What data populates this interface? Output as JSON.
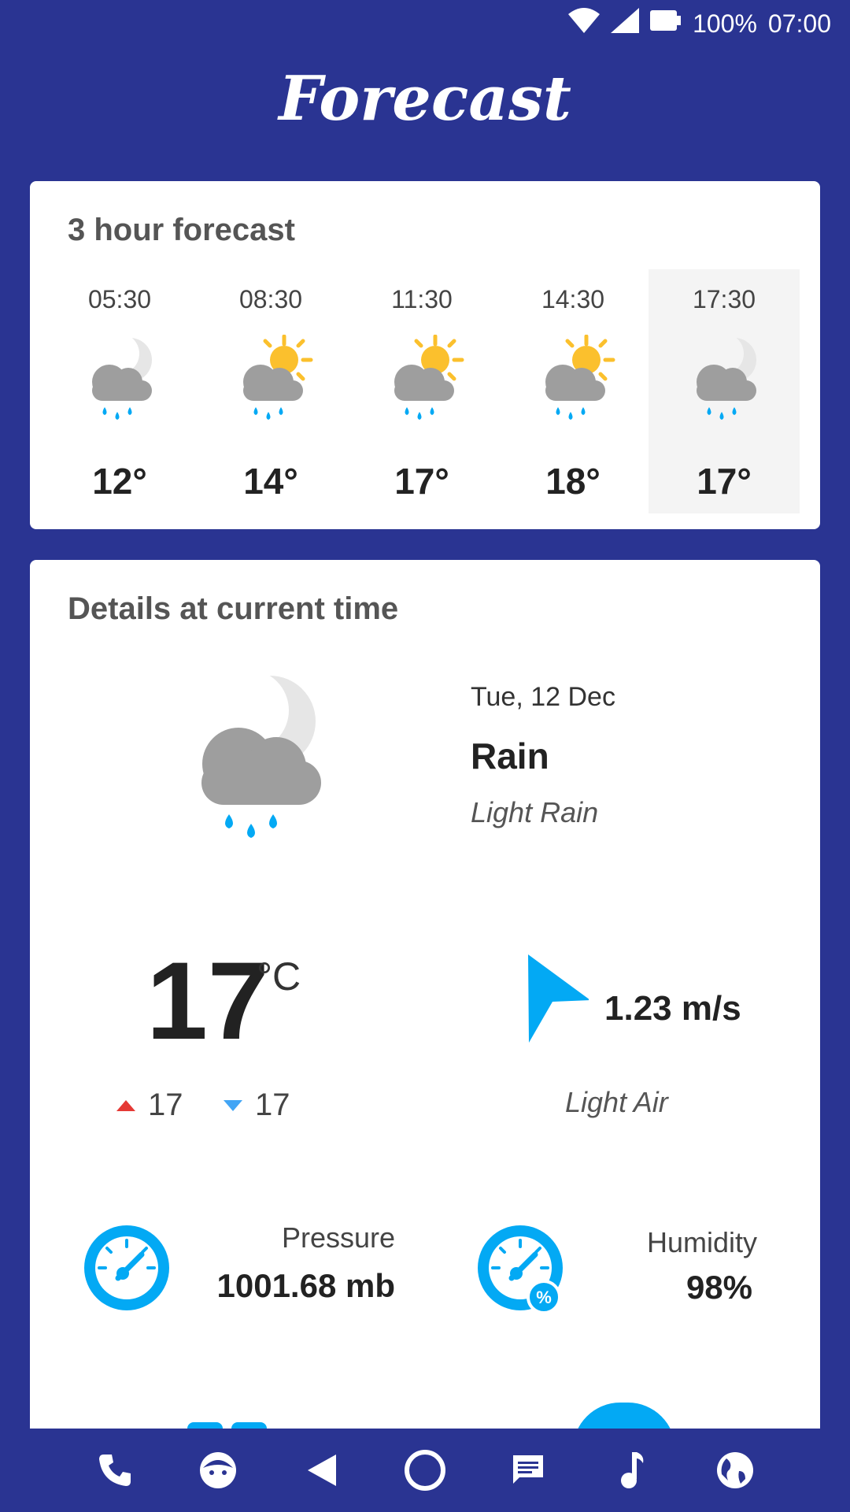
{
  "status": {
    "battery": "100%",
    "time": "07:00"
  },
  "app": {
    "title": "Forecast"
  },
  "three_hour": {
    "title": "3 hour forecast",
    "items": [
      {
        "time": "05:30",
        "temp": "12°",
        "icon": "night-rain-icon"
      },
      {
        "time": "08:30",
        "temp": "14°",
        "icon": "day-rain-icon"
      },
      {
        "time": "11:30",
        "temp": "17°",
        "icon": "day-rain-icon"
      },
      {
        "time": "14:30",
        "temp": "18°",
        "icon": "day-rain-icon"
      },
      {
        "time": "17:30",
        "temp": "17°",
        "icon": "night-rain-icon",
        "selected": true
      }
    ]
  },
  "details": {
    "title": "Details at current time",
    "date": "Tue, 12 Dec",
    "condition": "Rain",
    "description": "Light Rain",
    "temperature": "17",
    "unit": "°C",
    "high": "17",
    "low": "17",
    "wind_speed": "1.23 m/s",
    "wind_desc": "Light Air",
    "pressure_label": "Pressure",
    "pressure_value": "1001.68 mb",
    "humidity_label": "Humidity",
    "humidity_value": "98%",
    "humidity_badge": "%"
  },
  "colors": {
    "background": "#2a3492",
    "accent": "#03a9f4",
    "sun": "#fbc02d",
    "cloud": "#9e9e9e",
    "high": "#e53935",
    "low": "#42a5f5"
  },
  "nav_icons": [
    "phone-icon",
    "face-icon",
    "back-icon",
    "home-icon",
    "message-icon",
    "music-icon",
    "globe-icon"
  ]
}
